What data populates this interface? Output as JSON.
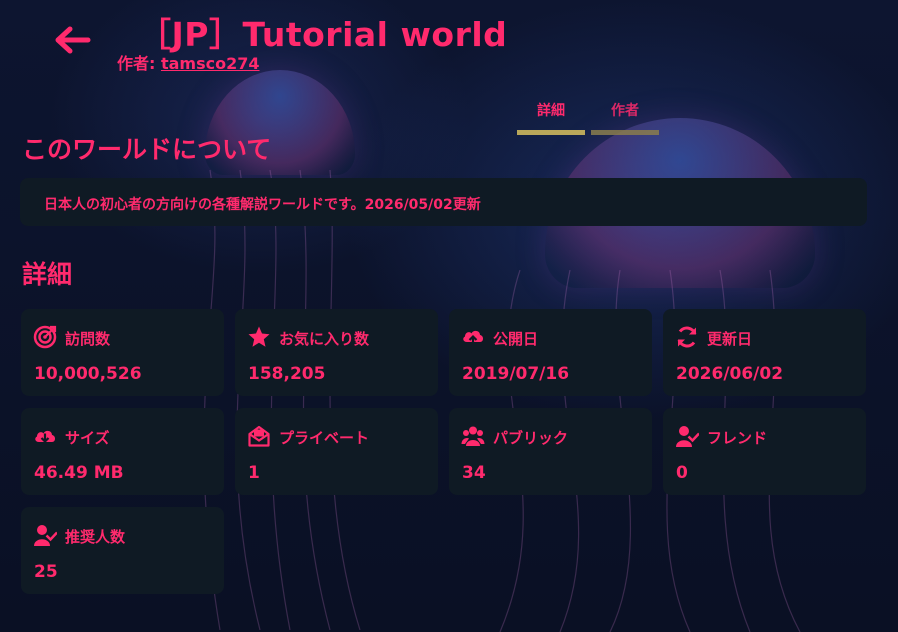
{
  "header": {
    "title": "［JP］Tutorial world",
    "author_prefix": "作者:",
    "author_name": "tamsco274"
  },
  "tabs": [
    {
      "label": "詳細"
    },
    {
      "label": "作者"
    }
  ],
  "about": {
    "heading": "このワールドについて",
    "description": "日本人の初心者の方向けの各種解説ワールドです。2026/05/02更新"
  },
  "details": {
    "heading": "詳細",
    "stats": [
      {
        "icon": "target-icon",
        "label": "訪問数",
        "value": "10,000,526"
      },
      {
        "icon": "star-icon",
        "label": "お気に入り数",
        "value": "158,205"
      },
      {
        "icon": "cloud-upload-icon",
        "label": "公開日",
        "value": "2019/07/16"
      },
      {
        "icon": "refresh-icon",
        "label": "更新日",
        "value": "2026/06/02"
      },
      {
        "icon": "cloud-download-icon",
        "label": "サイズ",
        "value": "46.49 MB"
      },
      {
        "icon": "private-envelope-icon",
        "label": "プライベート",
        "value": "1"
      },
      {
        "icon": "users-icon",
        "label": "パブリック",
        "value": "34"
      },
      {
        "icon": "friend-icon",
        "label": "フレンド",
        "value": "0"
      },
      {
        "icon": "friend-icon",
        "label": "推奨人数",
        "value": "25"
      }
    ]
  },
  "colors": {
    "accent": "#ff2a6d",
    "card": "#0f1a24",
    "tab_underline": "#b9a75a"
  }
}
